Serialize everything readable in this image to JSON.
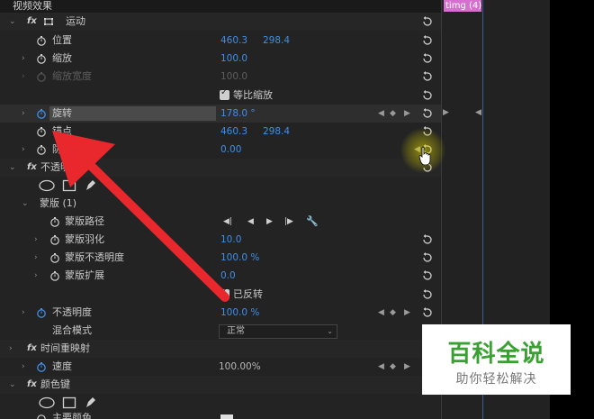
{
  "panel_title": "视频效果",
  "timeline_clip": "timg (4).",
  "motion": {
    "label": "运动",
    "position": {
      "label": "位置",
      "x": "460.3",
      "y": "298.4"
    },
    "scale": {
      "label": "缩放",
      "value": "100.0"
    },
    "scale_width": {
      "label": "缩放宽度",
      "value": "100.0"
    },
    "uniform_scale": {
      "label": "等比缩放"
    },
    "rotation": {
      "label": "旋转",
      "value": "178.0 °"
    },
    "anchor": {
      "label": "锚点",
      "x": "460.3",
      "y": "298.4"
    },
    "antiflicker": {
      "label": "防闪烁滤镜",
      "visible": "防",
      "value": "0.00"
    }
  },
  "opacity": {
    "label": "不透明",
    "mask": {
      "label": "蒙版 (1)",
      "path": {
        "label": "蒙版路径"
      },
      "feather": {
        "label": "蒙版羽化",
        "value": "10.0"
      },
      "opacity": {
        "label": "蒙版不透明度",
        "value": "100.0 %"
      },
      "expansion": {
        "label": "蒙版扩展",
        "value": "0.0"
      },
      "inverted": {
        "label": "已反转"
      }
    },
    "opacity_row": {
      "label": "不透明度",
      "value": "100.0 %"
    },
    "blend": {
      "label": "混合模式",
      "value": "正常"
    }
  },
  "time_remap": {
    "label": "时间重映射",
    "speed": {
      "label": "速度",
      "value": "100.00%"
    }
  },
  "color_key": {
    "label": "颜色键",
    "partial": "主要颜色"
  },
  "watermark": {
    "title": "百科全说",
    "subtitle": "助你轻松解决"
  },
  "colors": {
    "accent": "#3f8ee8",
    "arrow": "#e8282c",
    "clip": "#d66fd0",
    "watermark_green": "#3aa033"
  }
}
